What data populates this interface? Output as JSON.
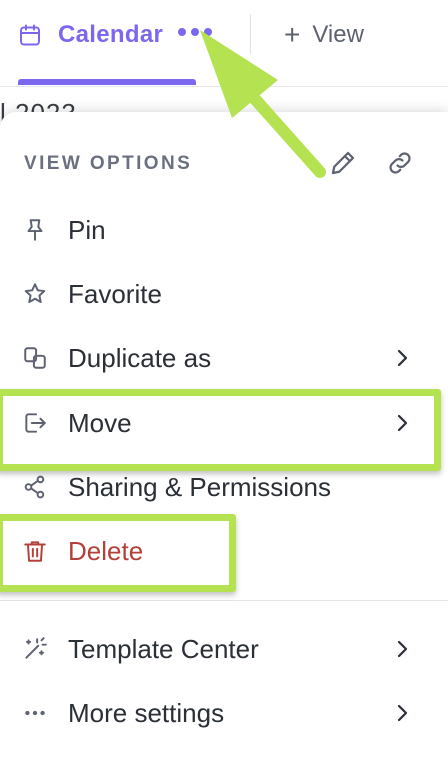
{
  "tabs": {
    "active_label": "Calendar",
    "add_view_label": "View"
  },
  "background": {
    "partial_text": "l 2023"
  },
  "menu": {
    "header": "VIEW OPTIONS",
    "items": [
      {
        "label": "Pin",
        "icon": "pin-icon",
        "has_submenu": false
      },
      {
        "label": "Favorite",
        "icon": "star-icon",
        "has_submenu": false
      },
      {
        "label": "Duplicate as",
        "icon": "duplicate-icon",
        "has_submenu": true
      },
      {
        "label": "Move",
        "icon": "move-icon",
        "has_submenu": true,
        "highlighted": true
      },
      {
        "label": "Sharing & Permissions",
        "icon": "share-icon",
        "has_submenu": false
      },
      {
        "label": "Delete",
        "icon": "trash-icon",
        "has_submenu": false,
        "highlighted": true
      },
      {
        "label": "Template Center",
        "icon": "magic-wand-icon",
        "has_submenu": true
      },
      {
        "label": "More settings",
        "icon": "more-dots-icon",
        "has_submenu": true
      }
    ]
  },
  "colors": {
    "accent": "#7b68ee",
    "danger": "#b3413a",
    "annotation": "#b5e251",
    "text": "#2b2f36",
    "muted": "#6b7080"
  }
}
